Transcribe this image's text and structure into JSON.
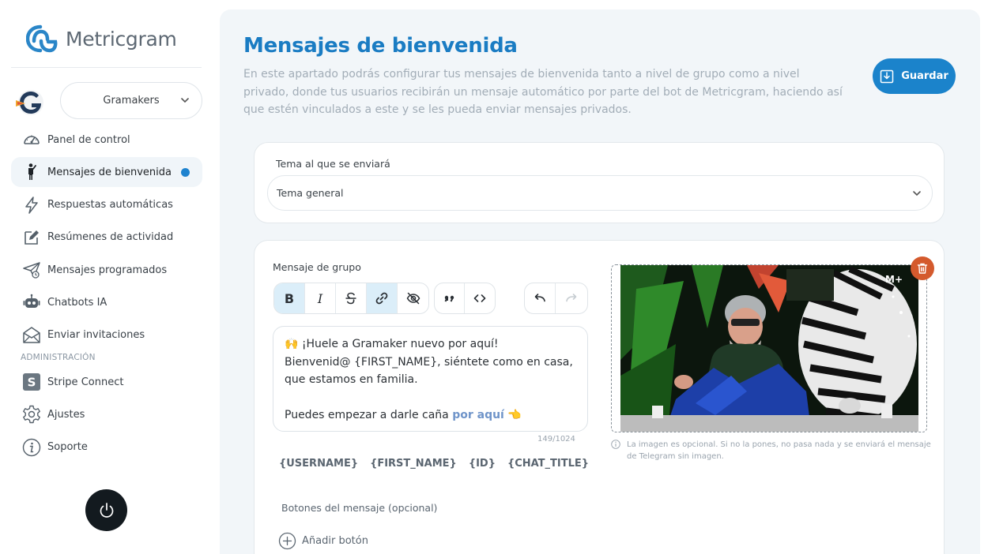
{
  "brand": {
    "name": "Metricgram",
    "accent": "#1b83cb"
  },
  "account": {
    "selected": "Gramakers"
  },
  "nav": {
    "items": [
      {
        "label": "Panel de control",
        "icon": "gauge-icon"
      },
      {
        "label": "Mensajes de bienvenida",
        "icon": "person-waving-icon",
        "active": true
      },
      {
        "label": "Respuestas automáticas",
        "icon": "lightning-icon"
      },
      {
        "label": "Resúmenes de actividad",
        "icon": "edit-icon"
      },
      {
        "label": "Mensajes programados",
        "icon": "send-clock-icon"
      },
      {
        "label": "Chatbots IA",
        "icon": "robot-icon"
      },
      {
        "label": "Enviar invitaciones",
        "icon": "mail-icon"
      }
    ],
    "admin_heading": "ADMINISTRACIÓN",
    "admin_items": [
      {
        "label": "Stripe Connect",
        "icon": "stripe-icon"
      },
      {
        "label": "Ajustes",
        "icon": "gear-icon"
      },
      {
        "label": "Soporte",
        "icon": "info-icon"
      }
    ]
  },
  "page": {
    "title": "Mensajes de bienvenida",
    "description": "En este apartado podrás configurar tus mensajes de bienvenida tanto a nivel de grupo como a nivel privado, donde tus usuarios recibirán un mensaje automático por parte del bot de Metricgram, haciendo así que estén vinculados a este y se les pueda enviar mensajes privados.",
    "save_label": "Guardar"
  },
  "topic": {
    "label": "Tema al que se enviará",
    "value": "Tema general"
  },
  "group_message": {
    "label": "Mensaje de grupo",
    "line1": "🙌 ¡Huele a Gramaker nuevo por aquí!",
    "line2": "Bienvenid@ {FIRST_NAME}, siéntete como en casa,",
    "line3": "que estamos en familia.",
    "line4_prefix": "Puedes empezar a darle caña ",
    "line4_link": "por aquí",
    "line4_suffix": " 👈",
    "counter": "149/1024",
    "variables": [
      "{USERNAME}",
      "{FIRST_NAME}",
      "{ID}",
      "{CHAT_TITLE}"
    ],
    "buttons_label": "Botones del mensaje (opcional)",
    "add_button_label": "Añadir botón"
  },
  "image": {
    "note": "La imagen es opcional. Si no la pones, no pasa nada y se enviará el mensaje de Telegram sin imagen.",
    "watermark": "M+"
  }
}
